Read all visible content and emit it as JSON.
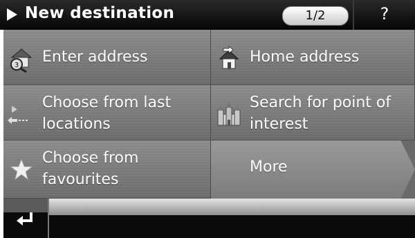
{
  "header": {
    "title": "New destination",
    "page_indicator": "1/2",
    "help_label": "?"
  },
  "menu": {
    "enter_address": "Enter address",
    "home_address": "Home address",
    "last_locations": "Choose from last locations",
    "point_of_interest": "Search for point of interest",
    "favourites": "Choose from favourites",
    "more": "More"
  },
  "icons": {
    "header": "play-arrow-icon",
    "enter_address": "house-magnifier-icon",
    "home_address": "home-icon",
    "last_locations": "recent-arrows-icon",
    "point_of_interest": "castle-icon",
    "favourites": "star-icon",
    "back": "return-arrow-icon"
  },
  "colors": {
    "header_bg": "#000000",
    "tile_bg": "#7a7a7a",
    "text": "#ffffff"
  }
}
